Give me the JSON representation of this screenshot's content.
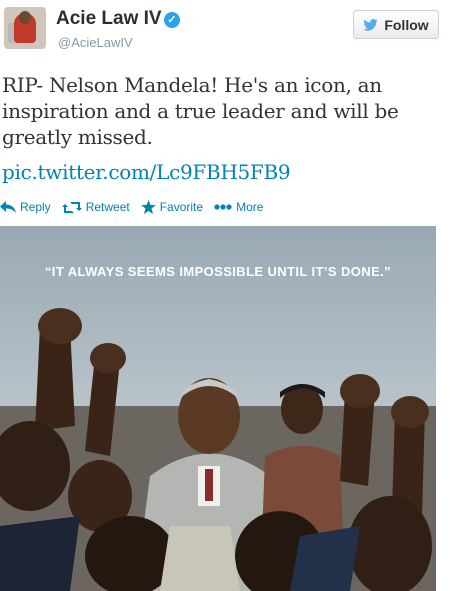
{
  "user": {
    "name": "Acie Law IV",
    "handle": "@AcieLawIV",
    "verified_icon": "verified-badge-icon",
    "avatar_icon": "profile-avatar"
  },
  "follow_button": {
    "label": "Follow",
    "icon": "twitter-bird-icon"
  },
  "tweet": {
    "text": "RIP- Nelson Mandela! He's an icon, an inspiration and a true leader and will be greatly missed.",
    "link": "pic.twitter.com/Lc9FBH5FB9"
  },
  "actions": {
    "reply": "Reply",
    "retweet": "Retweet",
    "favorite": "Favorite",
    "more": "More"
  },
  "photo": {
    "quote": "“IT ALWAYS SEEMS IMPOSSIBLE UNTIL IT’S DONE.”"
  },
  "colors": {
    "link": "#0084b4",
    "text": "#333333",
    "handle": "#8899a6",
    "verified": "#2aa3ef"
  }
}
